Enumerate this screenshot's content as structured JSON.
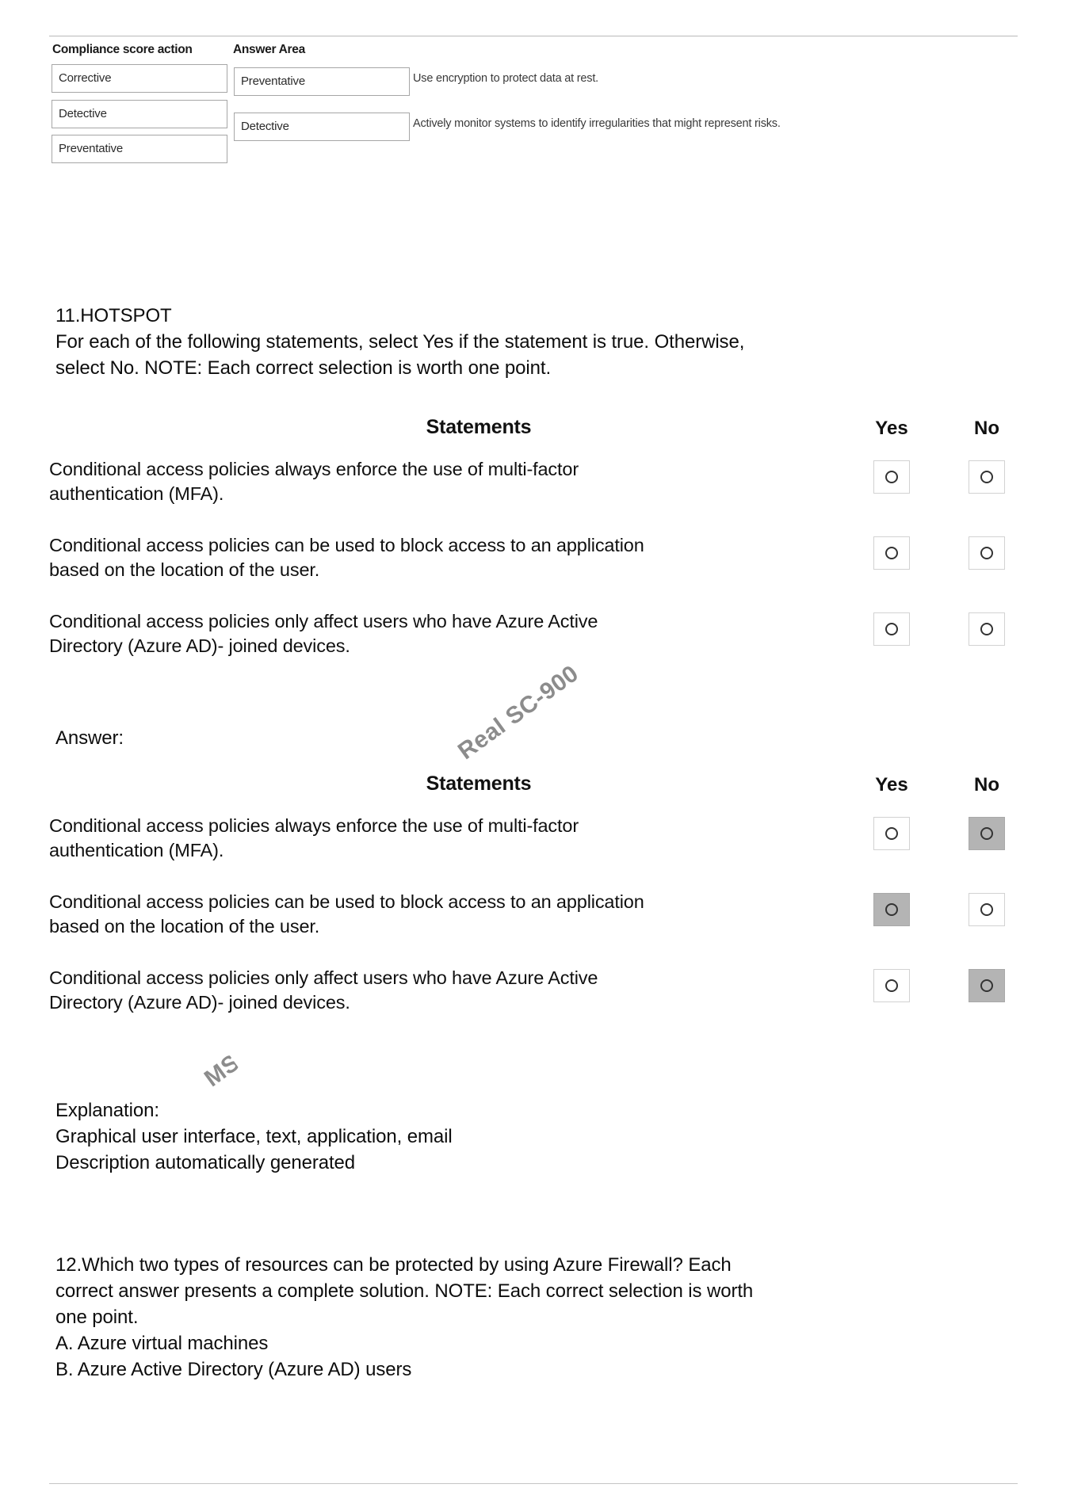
{
  "document": {
    "watermark_main": "Real SC-900",
    "watermark_partial": "MS"
  },
  "top_figure": {
    "column_header_left": "Compliance score action",
    "column_header_right": "Answer Area",
    "source_options": [
      "Corrective",
      "Detective",
      "Preventative"
    ],
    "answer_rows": [
      {
        "selected": "Preventative",
        "description": "Use encryption to protect data at rest."
      },
      {
        "selected": "Detective",
        "description": "Actively monitor systems to identify irregularities that might represent risks."
      }
    ]
  },
  "question11": {
    "number_and_type": "11.HOTSPOT",
    "prompt_line1": "For each of the following statements, select Yes if the statement is true. Otherwise,",
    "prompt_line2": "select No. NOTE: Each correct selection is worth one point.",
    "answer_label": "Answer:",
    "table_headers": {
      "statements": "Statements",
      "yes": "Yes",
      "no": "No"
    },
    "statements": [
      {
        "line1": "Conditional access policies always enforce the use of multi-factor",
        "line2": "authentication (MFA)."
      },
      {
        "line1": "Conditional access policies can be used to block access to an application",
        "line2": "based on the location of the user."
      },
      {
        "line1": "Conditional access policies only affect users who have Azure Active",
        "line2": "Directory (Azure AD)- joined devices."
      }
    ],
    "question_selections": [
      {
        "yes": false,
        "no": false
      },
      {
        "yes": false,
        "no": false
      },
      {
        "yes": false,
        "no": false
      }
    ],
    "answer_selections": [
      {
        "yes": false,
        "no": true
      },
      {
        "yes": true,
        "no": false
      },
      {
        "yes": false,
        "no": true
      }
    ],
    "explanation": {
      "label": "Explanation:",
      "line1": "Graphical user interface, text, application, email",
      "line2": "Description automatically generated"
    }
  },
  "question12": {
    "prompt_line1": "12.Which two types of resources can be protected by using Azure Firewall? Each",
    "prompt_line2": "correct answer presents a complete solution. NOTE: Each correct selection is worth",
    "prompt_line3": "one point.",
    "choices": [
      "A. Azure virtual machines",
      "B. Azure Active Directory (Azure AD) users"
    ]
  },
  "colors": {
    "selected_fill": "#b4b4b4",
    "box_border": "#d2d2d2",
    "rule": "#c4c4c4"
  }
}
